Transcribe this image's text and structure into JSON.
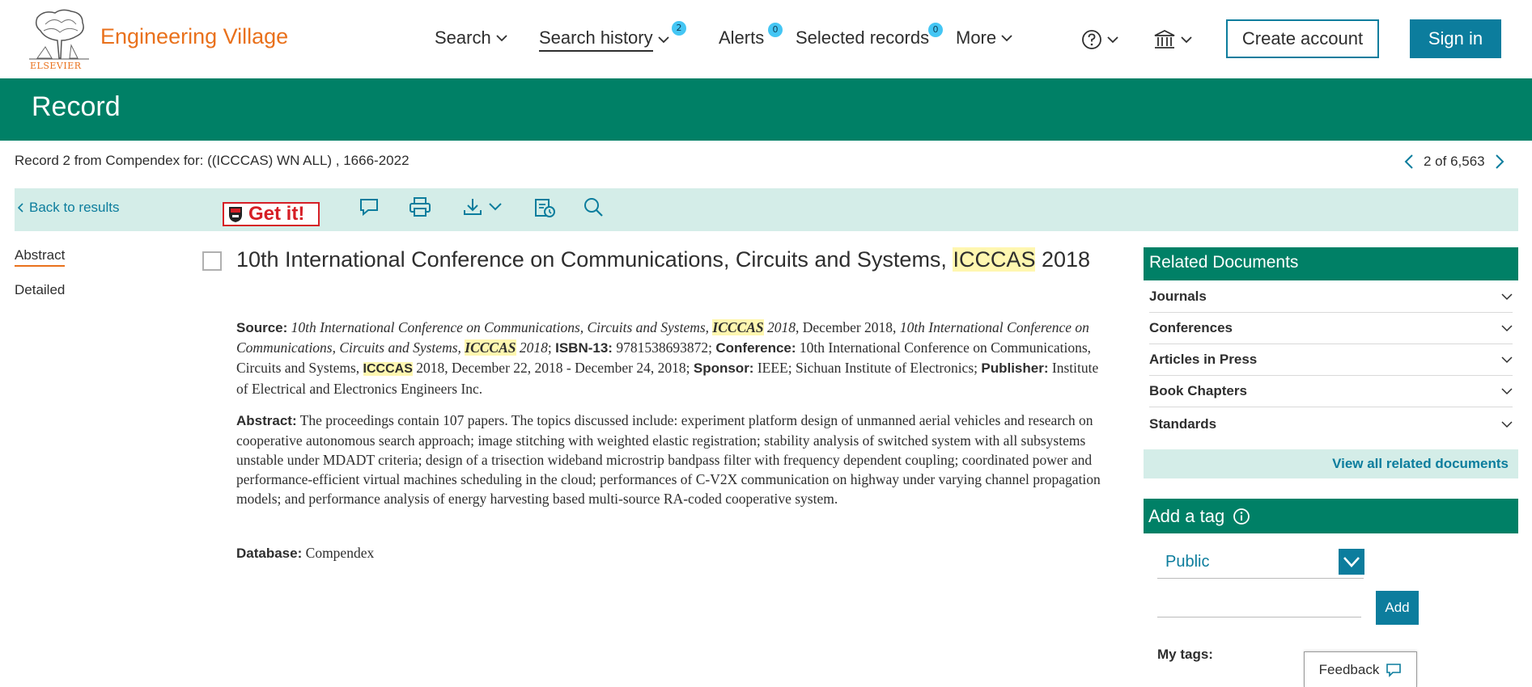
{
  "header": {
    "brand_mark": "ELSEVIER",
    "brand_name": "Engineering Village",
    "nav": {
      "search": "Search",
      "search_history": "Search history",
      "search_history_count": "2",
      "alerts": "Alerts",
      "alerts_count": "0",
      "selected_records": "Selected records",
      "selected_records_count": "0",
      "more": "More"
    },
    "create_account": "Create account",
    "sign_in": "Sign in"
  },
  "band": {
    "title": "Record"
  },
  "record_info": {
    "summary": "Record 2 from Compendex for: ((ICCCAS) WN ALL) , 1666-2022",
    "pager": "2 of 6,563"
  },
  "toolbar": {
    "back": "Back to results",
    "get_it": "Get it!"
  },
  "left_nav": {
    "abstract": "Abstract",
    "detailed": "Detailed"
  },
  "document": {
    "title_pre": "10th International Conference on Communications, Circuits and Systems, ",
    "title_hl": "ICCCAS",
    "title_post": " 2018",
    "source_label": "Source:",
    "source_1": "10th International Conference on Communications, Circuits and Systems, ",
    "source_hl_1": "ICCCAS",
    "source_2": " 2018",
    "source_3": ", December 2018, ",
    "source_4": "10th International Conference on Communications, Circuits and Systems, ",
    "source_hl_2": "ICCCAS",
    "source_5": " 2018",
    "source_6": ";  ",
    "isbn_label": "ISBN-13:",
    "isbn": " 9781538693872; ",
    "conference_label": "Conference:",
    "conference_1": " 10th International Conference on Communications, Circuits and Systems, ",
    "conference_hl": "ICCCAS",
    "conference_2": " 2018, December 22, 2018 - December 24, 2018; ",
    "sponsor_label": "Sponsor:",
    "sponsor": " IEEE; Sichuan Institute of Electronics; ",
    "publisher_label": "Publisher:",
    "publisher": " Institute of Electrical and Electronics Engineers Inc.",
    "abstract_label": "Abstract:",
    "abstract": " The proceedings contain 107 papers. The topics discussed include: experiment platform design of unmanned aerial vehicles and research on cooperative autonomous search approach; image stitching with weighted elastic registration; stability analysis of switched system with all subsystems unstable under MDADT criteria; design of a trisection wideband microstrip bandpass filter with frequency dependent coupling; coordinated power and performance-efficient virtual machines scheduling in the cloud; performances of C-V2X communication on highway under varying channel propagation models; and performance analysis of energy harvesting based multi-source RA-coded cooperative system.",
    "database_label": "Database:",
    "database": " Compendex"
  },
  "related": {
    "title": "Related Documents",
    "items": [
      "Journals",
      "Conferences",
      "Articles in Press",
      "Book Chapters",
      "Standards"
    ],
    "view_all": "View all related documents"
  },
  "tags": {
    "title": "Add a tag",
    "visibility": "Public",
    "add": "Add",
    "my_tags": "My tags:"
  },
  "feedback": "Feedback",
  "colors": {
    "brand_orange": "#e9711c",
    "teal_band": "#008066",
    "link_blue": "#0c7d9d",
    "badge_blue": "#44c6f4",
    "highlight": "#fff7b0"
  },
  "icons": [
    "elsevier-tree-icon",
    "chevron-down-icon",
    "help-icon",
    "institution-icon",
    "chevron-left-icon",
    "chevron-right-icon",
    "comment-icon",
    "print-icon",
    "download-icon",
    "save-record-icon",
    "search-icon",
    "info-icon",
    "feedback-icon"
  ]
}
